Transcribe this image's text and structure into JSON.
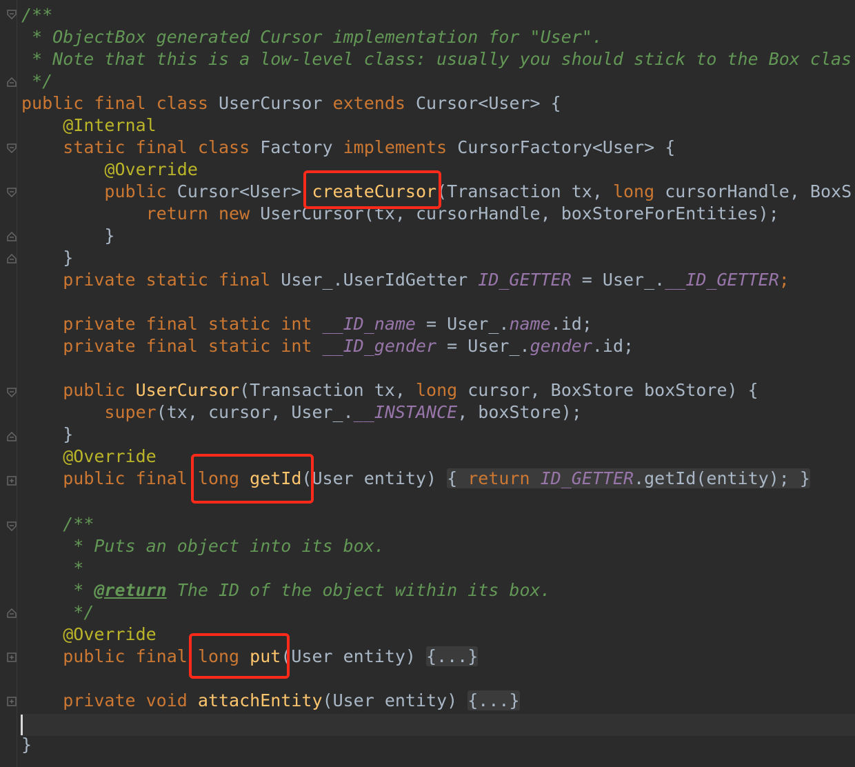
{
  "code": {
    "doc_open": "/**",
    "doc_line1": " * ObjectBox generated Cursor implementation for \"User\".",
    "doc_line2": " * Note that this is a low-level class: usually you should stick to the Box clas",
    "doc_close": " */",
    "class_kw": "public final class ",
    "class_name": "UserCursor ",
    "extends_kw": "extends ",
    "class_tail": "Cursor<User> {",
    "ann_internal": "@Internal",
    "factory_kw": "static final class ",
    "factory_name": "Factory ",
    "implements_kw": "implements ",
    "factory_tail": "CursorFactory<User> {",
    "ann_override": "@Override",
    "create_kw": "public ",
    "create_type": "Cursor<User> ",
    "create_name": "createCursor",
    "create_params_a": "(Transaction tx, ",
    "create_params_long": "long ",
    "create_params_b": "cursorHandle, BoxS",
    "return_kw": "return new ",
    "return_rest": "UserCursor(tx, cursorHandle, boxStoreForEntities);",
    "close_brace": "}",
    "getter_kw": "private static final ",
    "getter_type": "User_.UserIdGetter ",
    "getter_field": "ID_GETTER",
    "getter_mid": " = User_.",
    "getter_ref": "__ID_GETTER",
    "semicolon": ";",
    "pfs_int": "private final static int ",
    "name_field": "__ID_name",
    "name_mid": " = User_.",
    "name_ref": "name",
    "dot_id": ".id;",
    "gender_field": "__ID_gender",
    "gender_mid": " = User_.",
    "gender_ref": "gender",
    "ctor_kw": "public ",
    "ctor_name": "UserCursor",
    "ctor_params_a": "(Transaction tx, ",
    "ctor_params_long": "long ",
    "ctor_params_b": "cursor, BoxStore boxStore) {",
    "super_kw": "super",
    "super_args_a": "(tx, cursor, User_.",
    "super_instance": "__INSTANCE",
    "super_args_b": ", boxStore);",
    "getid_kw": "public final ",
    "getid_long": "long ",
    "getid_name": "getId",
    "getid_params": "(User entity) ",
    "getid_open": "{ ",
    "getid_return": "return ",
    "getid_field": "ID_GETTER",
    "getid_call": ".getId(entity);",
    "getid_close": " }",
    "doc2_open": "/**",
    "doc2_line1": " * Puts an object into its box.",
    "doc2_line2": " *",
    "doc2_line3_a": " * ",
    "doc2_tag": "@return",
    "doc2_line3_b": " The ID of the object within its box.",
    "doc2_close": " */",
    "put_kw": "public final ",
    "put_long": "long ",
    "put_name": "put",
    "put_params": "(User entity) ",
    "folded": "{...}",
    "attach_kw": "private void ",
    "attach_name": "attachEntity",
    "attach_params": "(User entity) ",
    "final_brace": "}"
  }
}
